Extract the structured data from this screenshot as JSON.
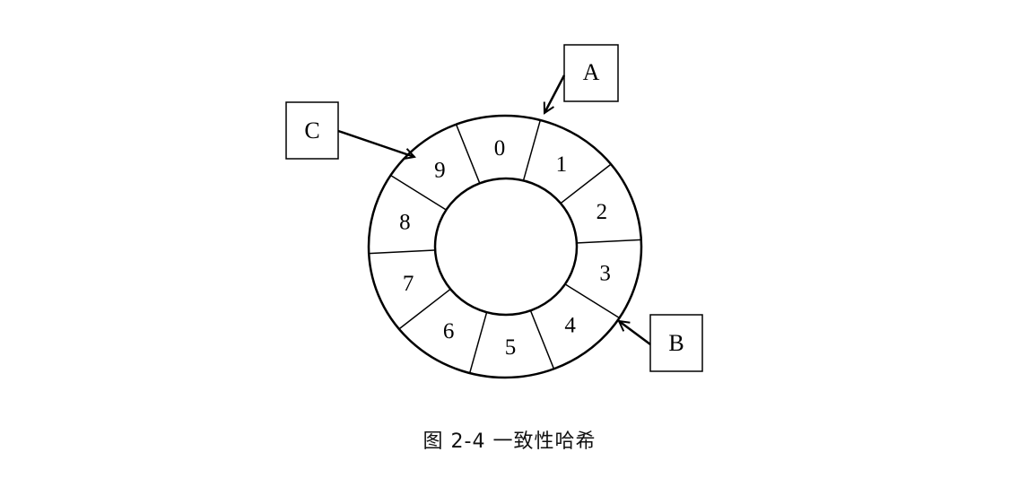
{
  "ring": {
    "segments": [
      "0",
      "1",
      "2",
      "3",
      "4",
      "5",
      "6",
      "7",
      "8",
      "9"
    ]
  },
  "nodes": [
    {
      "id": "A",
      "label": "A"
    },
    {
      "id": "B",
      "label": "B"
    },
    {
      "id": "C",
      "label": "C"
    }
  ],
  "caption": "图 2-4 一致性哈希"
}
